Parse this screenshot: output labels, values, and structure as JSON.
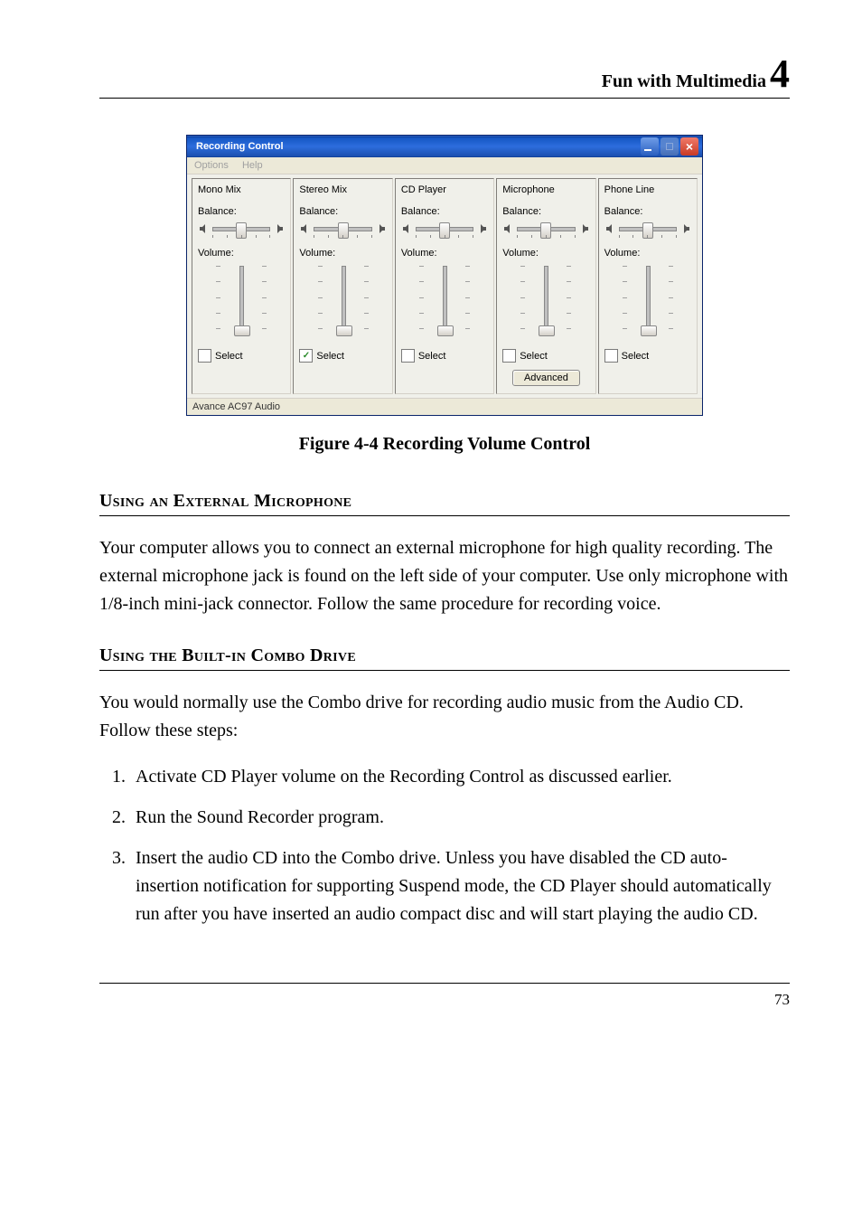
{
  "header": {
    "title": "Fun with Multimedia",
    "chapter_number": "4"
  },
  "window": {
    "title": "Recording Control",
    "menu": {
      "options": "Options",
      "help": "Help"
    },
    "labels": {
      "balance": "Balance:",
      "volume": "Volume:",
      "select": "Select",
      "advanced": "Advanced"
    },
    "columns": [
      {
        "title": "Mono Mix",
        "selected": false,
        "has_advanced": false
      },
      {
        "title": "Stereo Mix",
        "selected": true,
        "has_advanced": false
      },
      {
        "title": "CD Player",
        "selected": false,
        "has_advanced": false
      },
      {
        "title": "Microphone",
        "selected": false,
        "has_advanced": true
      },
      {
        "title": "Phone Line",
        "selected": false,
        "has_advanced": false
      }
    ],
    "status": "Avance AC97 Audio"
  },
  "figure_caption": "Figure 4-4 Recording Volume Control",
  "section1": {
    "heading": "Using an External Microphone",
    "body": "Your computer allows you to connect an external microphone for high quality recording. The external microphone jack is found on the left side of your computer. Use only microphone with 1/8-inch mini-jack connector. Follow the same procedure for recording voice."
  },
  "section2": {
    "heading": "Using the Built-in Combo Drive",
    "intro": "You would normally use the Combo drive for recording audio music from the Audio CD. Follow these steps:",
    "steps": [
      "Activate CD Player volume on the Recording Control as discussed earlier.",
      "Run the Sound Recorder program.",
      "Insert the audio CD into the Combo drive. Unless you have disabled the CD auto-insertion notification for supporting Suspend mode, the CD Player should automatically run after you have inserted an audio compact disc and will start playing the audio CD."
    ]
  },
  "page_number": "73"
}
